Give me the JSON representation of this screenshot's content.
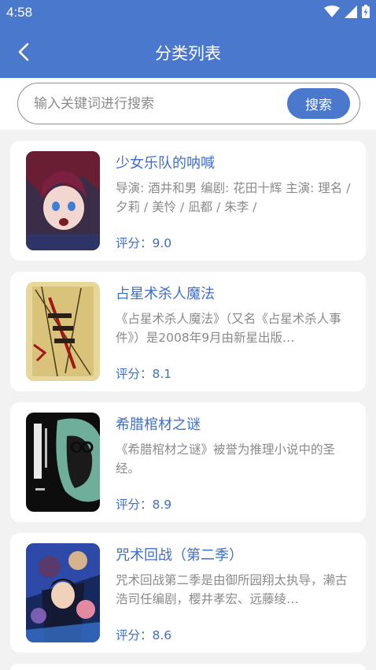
{
  "status_bar": {
    "time": "4:58"
  },
  "header": {
    "title": "分类列表"
  },
  "search": {
    "placeholder": "输入关键词进行搜索",
    "button_label": "搜索"
  },
  "items": [
    {
      "title": "少女乐队的呐喊",
      "desc": "导演: 酒井和男 编剧: 花田十辉 主演: 理名 / 夕莉 / 美怜 / 凪都 / 朱李 /",
      "score": "评分：9.0"
    },
    {
      "title": "占星术杀人魔法",
      "desc": "《占星术杀人魔法》（又名《占星术杀人事件》）是2008年9月由新星出版…",
      "score": "评分：8.1"
    },
    {
      "title": "希腊棺材之谜",
      "desc": "《希腊棺材之谜》被誉为推理小说中的圣经。",
      "score": "评分：8.9"
    },
    {
      "title": "咒术回战（第二季）",
      "desc": "咒术回战第二季是由御所园翔太执导，濑古浩司任编剧，樱井孝宏、远藤绫…",
      "score": "评分：8.6"
    }
  ]
}
